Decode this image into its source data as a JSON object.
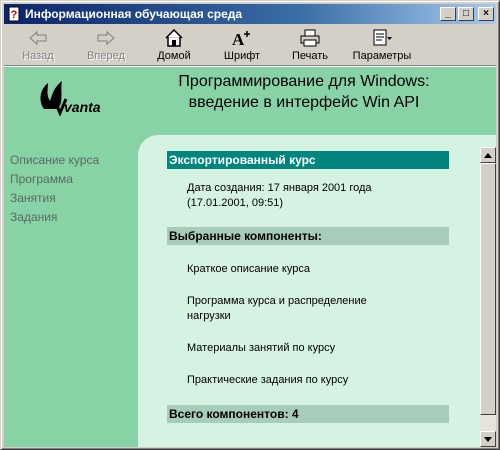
{
  "window": {
    "title": "Информационная обучающая среда",
    "controls": {
      "minimize": "_",
      "maximize": "□",
      "close": "×"
    }
  },
  "toolbar": {
    "back_label": "Назад",
    "forward_label": "Вперед",
    "home_label": "Домой",
    "font_label": "Шрифт",
    "print_label": "Печать",
    "params_label": "Параметры"
  },
  "header": {
    "logo_text": "vanta",
    "title_line1": "Программирование для Windows:",
    "title_line2": "введение в интерфейс Win API"
  },
  "sidebar": {
    "items": [
      {
        "label": "Описание курса"
      },
      {
        "label": "Программа"
      },
      {
        "label": "Занятия"
      },
      {
        "label": "Задания"
      }
    ]
  },
  "main": {
    "exported_heading": "Экспортированный курс",
    "created_line1": "Дата создания: 17 января 2001 года",
    "created_line2": "(17.01.2001, 09:51)",
    "components_heading": "Выбранные компоненты:",
    "components": [
      {
        "line1": "Краткое описание курса",
        "line2": ""
      },
      {
        "line1": "Программа курса и распределение",
        "line2": "нагрузки"
      },
      {
        "line1": "Материалы занятий по курсу",
        "line2": ""
      },
      {
        "line1": "Практические задания по курсу",
        "line2": ""
      }
    ],
    "total_heading": "Всего компонентов: 4"
  },
  "colors": {
    "panel_green": "#88d3a5",
    "content_bg": "#d6f2e2",
    "heading_teal": "#00857f",
    "heading_gray": "#a8ccba"
  }
}
